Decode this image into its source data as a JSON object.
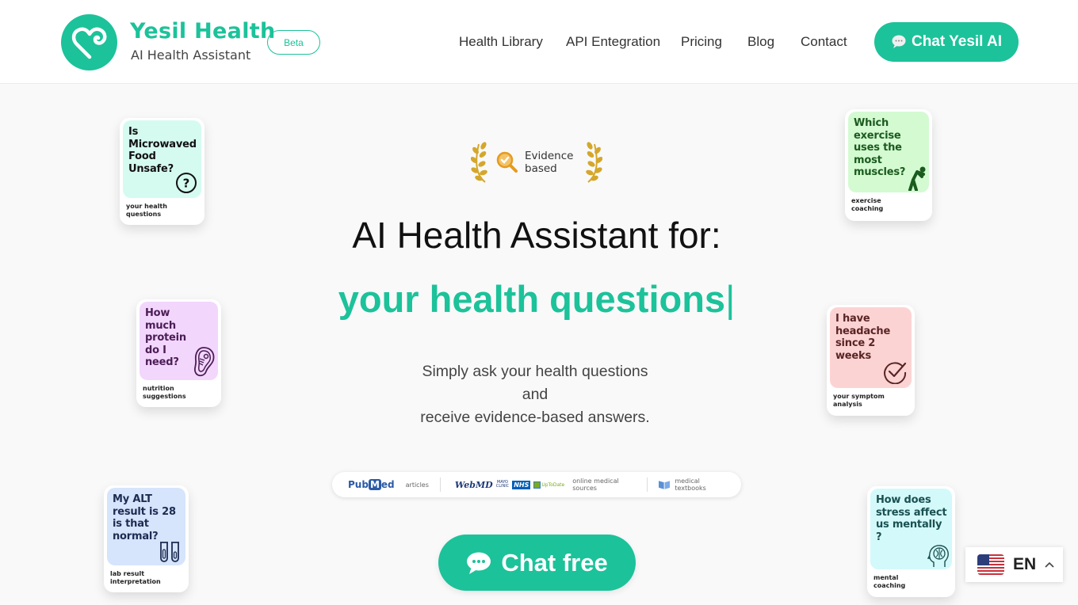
{
  "brand": {
    "name": "Yesil Health",
    "subtitle": "AI Health Assistant",
    "badge": "Beta",
    "color": "#1cc29a"
  },
  "nav": {
    "items": [
      {
        "label": "Health Library"
      },
      {
        "label": "API Entegration"
      },
      {
        "label": "Pricing"
      },
      {
        "label": "Blog"
      },
      {
        "label": "Contact"
      }
    ],
    "cta_label": "Chat Yesil AI",
    "cta_icon": "chat-bubble-icon"
  },
  "hero": {
    "badge_text_line1": "Evidence",
    "badge_text_line2": "based",
    "title": "AI Health Assistant for:",
    "typed_text": "your health questions",
    "typed_cursor": "|",
    "subtitle_line1": "Simply ask your health questions",
    "subtitle_line2": "and",
    "subtitle_line3": "receive evidence-based answers."
  },
  "sources": {
    "pubmed_pre": "Pub",
    "pubmed_m": "M",
    "pubmed_post": "ed",
    "articles_label": "articles",
    "webmd": "WebMD",
    "mayo_line1": "MAYO",
    "mayo_line2": "CLINIC",
    "nhs": "NHS",
    "uptodate": "UpToDate",
    "online_label": "online medical sources",
    "textbooks_label": "medical textbooks"
  },
  "cta": {
    "chat_free_label": "Chat free"
  },
  "cards": [
    {
      "question": "Is Microwaved Food Unsafe?",
      "label_line1": "your health",
      "label_line2": "questions",
      "bg": "#d5fbf1",
      "text_color": "#111111",
      "icon": "question-circle-icon"
    },
    {
      "question": "Which exercise uses the most muscles?",
      "label_line1": "exercise",
      "label_line2": "coaching",
      "bg": "#d4fad2",
      "text_color": "#1b5b1e",
      "icon": "stretching-person-icon"
    },
    {
      "question": "How much protein do I need?",
      "label_line1": "nutrition",
      "label_line2": "suggestions",
      "bg": "#f2d6fc",
      "text_color": "#4b1d55",
      "icon": "steak-icon"
    },
    {
      "question": "I have headache since 2 weeks",
      "label_line1": "your symptom",
      "label_line2": "analysis",
      "bg": "#fcd3d3",
      "text_color": "#5a2424",
      "icon": "check-circle-icon"
    },
    {
      "question": "My ALT result is 28 is that normal?",
      "label_line1": "lab result",
      "label_line2": "interpretation",
      "bg": "#d6e4fc",
      "text_color": "#1e2c52",
      "icon": "test-tubes-icon"
    },
    {
      "question": "How does stress affect us mentally ?",
      "label_line1": "mental",
      "label_line2": "coaching",
      "bg": "#d3f9fb",
      "text_color": "#1a5050",
      "icon": "head-brain-icon"
    }
  ],
  "language": {
    "code": "EN",
    "flag": "us-flag-icon"
  }
}
